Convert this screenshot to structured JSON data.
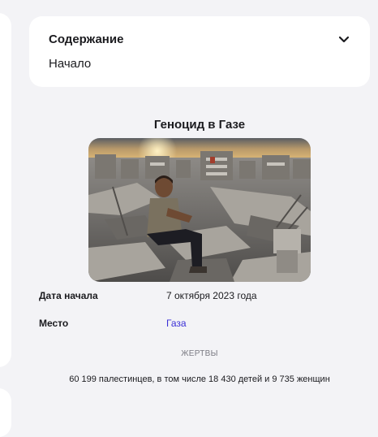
{
  "toc": {
    "title": "Содержание",
    "items": [
      "Начало"
    ]
  },
  "infobox": {
    "title": "Геноцид в Газе",
    "image_alt": "Мальчик сидит на развалинах разрушенных зданий",
    "rows": [
      {
        "label": "Дата начала",
        "value": "7 октября 2023 года"
      },
      {
        "label": "Место",
        "value": "Газа"
      }
    ],
    "section_header": "ЖЕРТВЫ",
    "casualties": "60 199 палестинцев, в том числе 18 430 детей и 9 735 женщин"
  },
  "colors": {
    "page_background": "#f3f3f6",
    "card_background": "#ffffff",
    "link": "#3a2fd6",
    "muted_text": "#7a7a82"
  },
  "icons": {
    "toc_toggle": "chevron-down-icon"
  }
}
